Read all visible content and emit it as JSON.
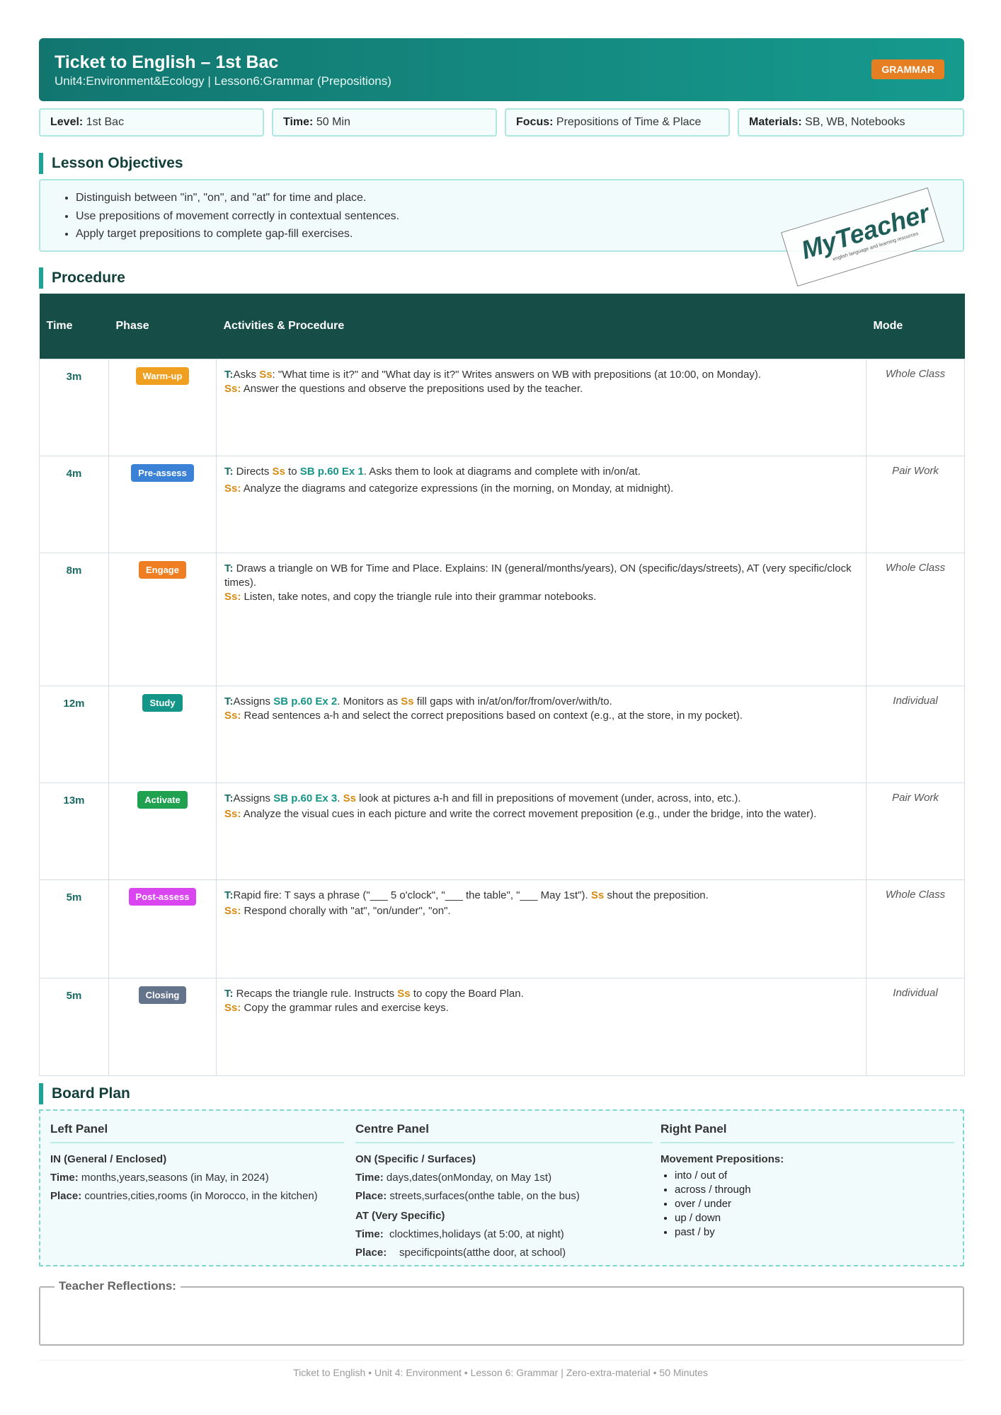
{
  "header": {
    "title": "Ticket to English – 1st Bac",
    "subtitle": "Unit4:Environment&Ecology | Lesson6:Grammar (Prepositions)",
    "badge": "GRAMMAR"
  },
  "info": [
    {
      "label": "Level:",
      "value": "1st Bac"
    },
    {
      "label": "Time:",
      "value": "50 Min"
    },
    {
      "label": "Focus:",
      "value": "Prepositions of Time & Place"
    },
    {
      "label": "Materials:",
      "value": "SB, WB, Notebooks"
    }
  ],
  "objectives": {
    "title": "Lesson Objectives",
    "items": [
      "Distinguish between \"in\", \"on\", and \"at\" for time and place.",
      "Use prepositions of movement correctly in contextual sentences.",
      "Apply target prepositions to complete gap-fill exercises."
    ]
  },
  "stamp": {
    "logo": "MyTeacher",
    "tagline": "english language and learning resources"
  },
  "procedure": {
    "title": "Procedure",
    "headers": [
      "Time",
      "Phase",
      "Activities & Procedure",
      "Mode"
    ],
    "rows": [
      {
        "time": "3m",
        "phase": "Warm-up",
        "phase_color": "#f0a020",
        "t_label": "T:",
        "t1": "Asks ",
        "t_ss": "Ss",
        "t2": ": \"What time is it?\" and \"What day is it?\" Writes answers on WB with prepositions (at 10:00, on Monday).",
        "s_label": "Ss:",
        "s_text": "Answer the questions and observe the prepositions used by the teacher.",
        "mode": "Whole Class"
      },
      {
        "time": "4m",
        "phase": "Pre-assess",
        "phase_color": "#3b82d6",
        "t_label": "T:",
        "t1": "Directs ",
        "t_ss": "Ss",
        "t_mid": " to ",
        "t_ref": "SB p.60 Ex 1",
        "t2": ". Asks them to look at diagrams and complete with in/on/at.",
        "s_label": "Ss:",
        "s_text": "Analyze the diagrams and categorize expressions (in the morning, on Monday, at midnight).",
        "mode": "Pair Work"
      },
      {
        "time": "8m",
        "phase": "Engage",
        "phase_color": "#ef7d22",
        "t_label": "T:",
        "t1": "Draws a triangle on WB for Time and Place. Explains: IN (general/months/years), ON (specific/days/streets), AT (very specific/clock times).",
        "s_label": "Ss:",
        "s_text": "Listen, take notes, and copy the triangle rule into their grammar notebooks.",
        "mode": "Whole Class"
      },
      {
        "time": "12m",
        "phase": "Study",
        "phase_color": "#139688",
        "t_label": "T:",
        "t1": "Assigns ",
        "t_ref": "SB p.60 Ex 2",
        "t_mid": ". Monitors as ",
        "t_ss": "Ss",
        "t2": " fill gaps with in/at/on/for/from/over/with/to.",
        "s_label": "Ss:",
        "s_text": "Read sentences a-h and select the correct prepositions based on context (e.g., at the store, in my pocket).",
        "mode": "Individual"
      },
      {
        "time": "13m",
        "phase": "Activate",
        "phase_color": "#1fa150",
        "t_label": "T:",
        "t1": "Assigns ",
        "t_ref": "SB p.60 Ex 3",
        "t_mid": ". ",
        "t_ss": "Ss",
        "t2": " look at pictures a-h and fill in prepositions of movement (under, across, into, etc.).",
        "s_label": "Ss:",
        "s_text": "Analyze the visual cues in each picture and write the correct movement preposition (e.g., under the bridge, into the water).",
        "mode": "Pair Work"
      },
      {
        "time": "5m",
        "phase": "Post-assess",
        "phase_color": "#d946ef",
        "t_label": "T:",
        "t1": "Rapid fire: T says a phrase (\"___ 5 o'clock\", \"___ the table\", \"___ May 1st\"). ",
        "t_ss": "Ss",
        "t2": " shout the preposition.",
        "s_label": "Ss:",
        "s_text": "Respond chorally with \"at\", \"on/under\", \"on\".",
        "mode": "Whole Class"
      },
      {
        "time": "5m",
        "phase": "Closing",
        "phase_color": "#64748b",
        "t_label": "T:",
        "t1": "Recaps the triangle rule. Instructs ",
        "t_ss": "Ss",
        "t2": " to copy the Board Plan.",
        "s_label": "Ss:",
        "s_text": "Copy the grammar rules and exercise keys.",
        "mode": "Individual"
      }
    ]
  },
  "board": {
    "title": "Board Plan",
    "left": {
      "title": "Left Panel",
      "heading": "IN (General / Enclosed)",
      "time_label": "Time:",
      "time_text": " months,years,seasons (in May, in 2024)",
      "place_label": "Place:",
      "place_text": " countries,cities,rooms (in Morocco, in the kitchen)"
    },
    "centre": {
      "title": "Centre Panel",
      "heading": "ON (Specific / Surfaces)",
      "time_label": "Time:",
      "time_text": " days,dates(onMonday, on May 1st)",
      "place_label": "Place:",
      "place_text": " streets,surfaces(onthe table, on the bus)",
      "heading2": "AT (Very Specific)",
      "time2_label": "Time:",
      "time2_text": "clocktimes,holidays (at 5:00, at night)",
      "place2_label": "Place:",
      "place2_text": "specificpoints(atthe door, at school)"
    },
    "right": {
      "title": "Right Panel",
      "heading": "Movement Prepositions:",
      "items": [
        "into / out of",
        "across / through",
        "over / under",
        "up / down",
        "past / by"
      ]
    }
  },
  "reflections": {
    "label": "Teacher Reflections:"
  },
  "footer": "Ticket to English • Unit 4: Environment • Lesson 6: Grammar | Zero-extra-material • 50 Minutes"
}
